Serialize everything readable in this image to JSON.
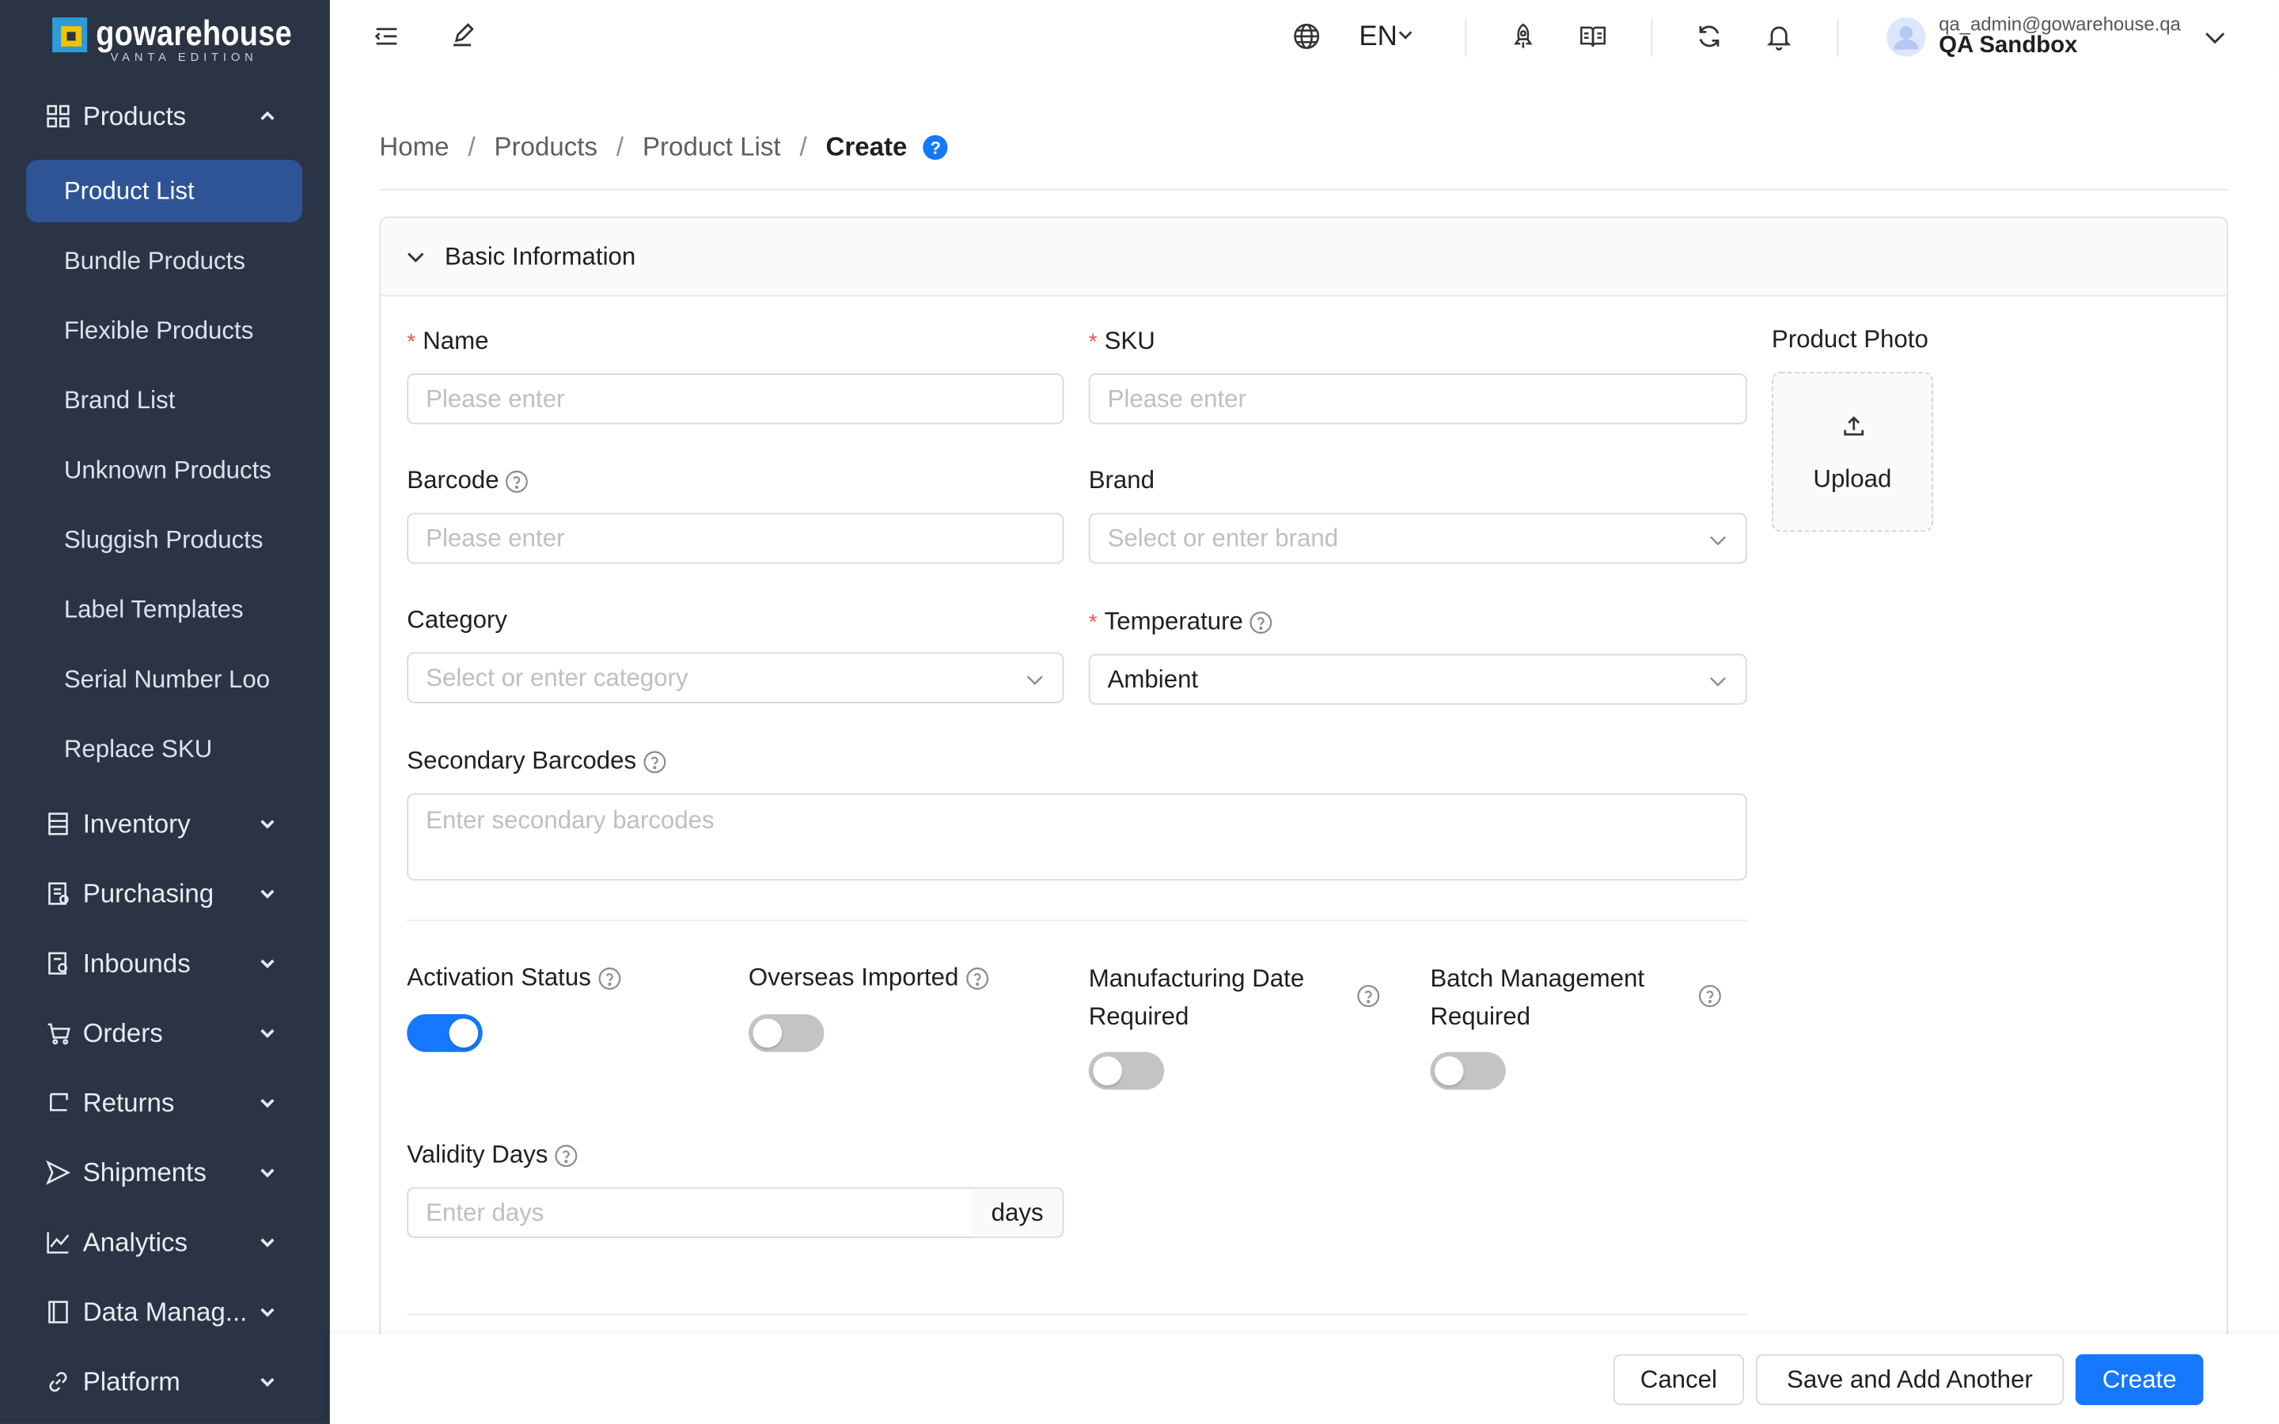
{
  "app": {
    "logo_name": "gowarehouse",
    "logo_sub": "VANTA EDITION"
  },
  "sidebar": {
    "groups": [
      {
        "label": "Products",
        "icon": "grid-icon",
        "expanded": true
      },
      {
        "label": "Inventory",
        "icon": "inventory-icon"
      },
      {
        "label": "Purchasing",
        "icon": "purchasing-icon"
      },
      {
        "label": "Inbounds",
        "icon": "inbounds-icon"
      },
      {
        "label": "Orders",
        "icon": "cart-icon"
      },
      {
        "label": "Returns",
        "icon": "return-icon"
      },
      {
        "label": "Shipments",
        "icon": "send-icon"
      },
      {
        "label": "Analytics",
        "icon": "chart-icon"
      },
      {
        "label": "Data Manag...",
        "icon": "book-icon"
      },
      {
        "label": "Platform",
        "icon": "link-icon"
      }
    ],
    "product_items": [
      {
        "label": "Product List",
        "active": true
      },
      {
        "label": "Bundle Products"
      },
      {
        "label": "Flexible Products"
      },
      {
        "label": "Brand List"
      },
      {
        "label": "Unknown Products"
      },
      {
        "label": "Sluggish Products"
      },
      {
        "label": "Label Templates"
      },
      {
        "label": "Serial Number Loo"
      },
      {
        "label": "Replace SKU"
      }
    ]
  },
  "header": {
    "language": "EN",
    "user_email": "qa_admin@gowarehouse.qa",
    "user_org": "QA Sandbox"
  },
  "breadcrumb": {
    "items": [
      "Home",
      "Products",
      "Product List"
    ],
    "current": "Create",
    "help_glyph": "?"
  },
  "form": {
    "section_title": "Basic Information",
    "name": {
      "label": "Name",
      "placeholder": "Please enter",
      "required": true
    },
    "sku": {
      "label": "SKU",
      "placeholder": "Please enter",
      "required": true
    },
    "product_photo": {
      "label": "Product Photo",
      "upload_label": "Upload"
    },
    "barcode": {
      "label": "Barcode",
      "placeholder": "Please enter"
    },
    "brand": {
      "label": "Brand",
      "placeholder": "Select or enter brand"
    },
    "category": {
      "label": "Category",
      "placeholder": "Select or enter category"
    },
    "temperature": {
      "label": "Temperature",
      "value": "Ambient",
      "required": true
    },
    "secondary_barcodes": {
      "label": "Secondary Barcodes",
      "placeholder": "Enter secondary barcodes"
    },
    "activation_status": {
      "label": "Activation Status",
      "on": true
    },
    "overseas_imported": {
      "label": "Overseas Imported",
      "on": false
    },
    "manufacturing_date": {
      "label_line1": "Manufacturing Date",
      "label_line2": "Required",
      "on": false
    },
    "batch_management": {
      "label_line1": "Batch Management",
      "label_line2": "Required",
      "on": false
    },
    "validity_days": {
      "label": "Validity Days",
      "placeholder": "Enter days",
      "suffix": "days"
    }
  },
  "footer": {
    "cancel": "Cancel",
    "save_add": "Save and Add Another",
    "create": "Create"
  },
  "colors": {
    "sidebar_bg": "#2a3445",
    "active_item": "#2e5496",
    "primary": "#1677ff",
    "required": "#ff4d4f"
  }
}
